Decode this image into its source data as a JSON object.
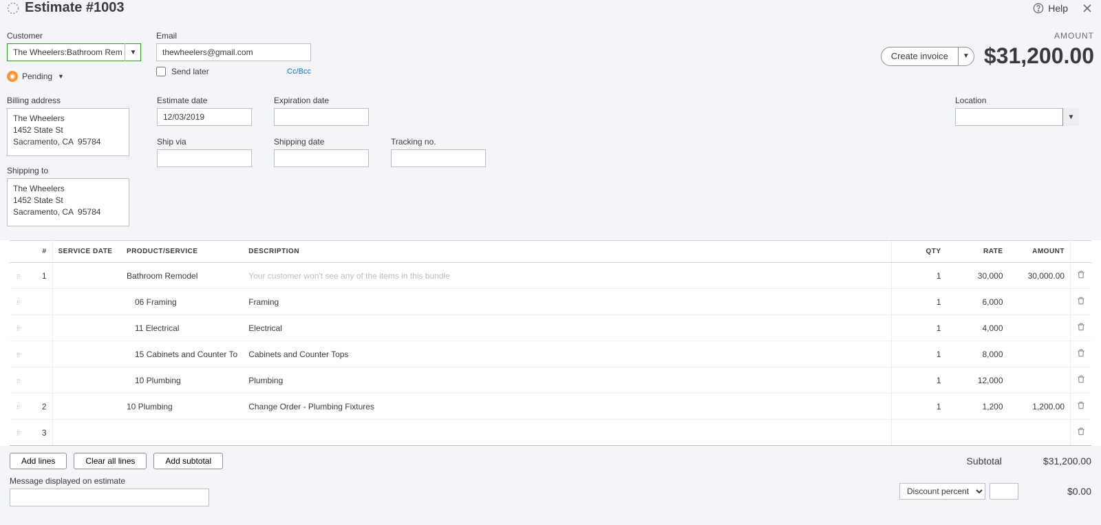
{
  "header": {
    "title": "Estimate #1003",
    "help_label": "Help",
    "amount_label": "AMOUNT",
    "amount_value": "$31,200.00",
    "create_invoice_label": "Create invoice"
  },
  "fields": {
    "customer_label": "Customer",
    "customer_value": "The Wheelers:Bathroom Remode",
    "email_label": "Email",
    "email_value": "thewheelers@gmail.com",
    "send_later_label": "Send later",
    "ccbcc_label": "Cc/Bcc",
    "status_label": "Pending",
    "billing_label": "Billing address",
    "billing_value": "The Wheelers\n1452 State St\nSacramento, CA  95784",
    "shipping_label": "Shipping to",
    "shipping_value": "The Wheelers\n1452 State St\nSacramento, CA  95784",
    "estimate_date_label": "Estimate date",
    "estimate_date_value": "12/03/2019",
    "expiration_label": "Expiration date",
    "ship_via_label": "Ship via",
    "shipping_date_label": "Shipping date",
    "tracking_label": "Tracking no.",
    "location_label": "Location"
  },
  "table": {
    "headers": {
      "num": "#",
      "service_date": "SERVICE DATE",
      "product": "PRODUCT/SERVICE",
      "description": "DESCRIPTION",
      "qty": "QTY",
      "rate": "RATE",
      "amount": "AMOUNT"
    },
    "rows": [
      {
        "num": "1",
        "product": "Bathroom Remodel",
        "description": "Your customer won't see any of the items in this bundle",
        "placeholder": true,
        "qty": "1",
        "rate": "30,000",
        "amount": "30,000.00"
      },
      {
        "num": "",
        "product": "06 Framing",
        "description": "Framing",
        "qty": "1",
        "rate": "6,000",
        "amount": ""
      },
      {
        "num": "",
        "product": "11 Electrical",
        "description": "Electrical",
        "qty": "1",
        "rate": "4,000",
        "amount": ""
      },
      {
        "num": "",
        "product": "15 Cabinets and Counter To",
        "description": "Cabinets and Counter Tops",
        "qty": "1",
        "rate": "8,000",
        "amount": ""
      },
      {
        "num": "",
        "product": "10 Plumbing",
        "description": "Plumbing",
        "qty": "1",
        "rate": "12,000",
        "amount": ""
      },
      {
        "num": "2",
        "product": "10 Plumbing",
        "description": "Change Order - Plumbing Fixtures",
        "qty": "1",
        "rate": "1,200",
        "amount": "1,200.00"
      },
      {
        "num": "3",
        "product": "",
        "description": "",
        "qty": "",
        "rate": "",
        "amount": ""
      }
    ]
  },
  "footer": {
    "add_lines": "Add lines",
    "clear_lines": "Clear all lines",
    "add_subtotal": "Add subtotal",
    "subtotal_label": "Subtotal",
    "subtotal_value": "$31,200.00",
    "message_label": "Message displayed on estimate",
    "discount_label": "Discount percent",
    "discount_value": "$0.00"
  }
}
